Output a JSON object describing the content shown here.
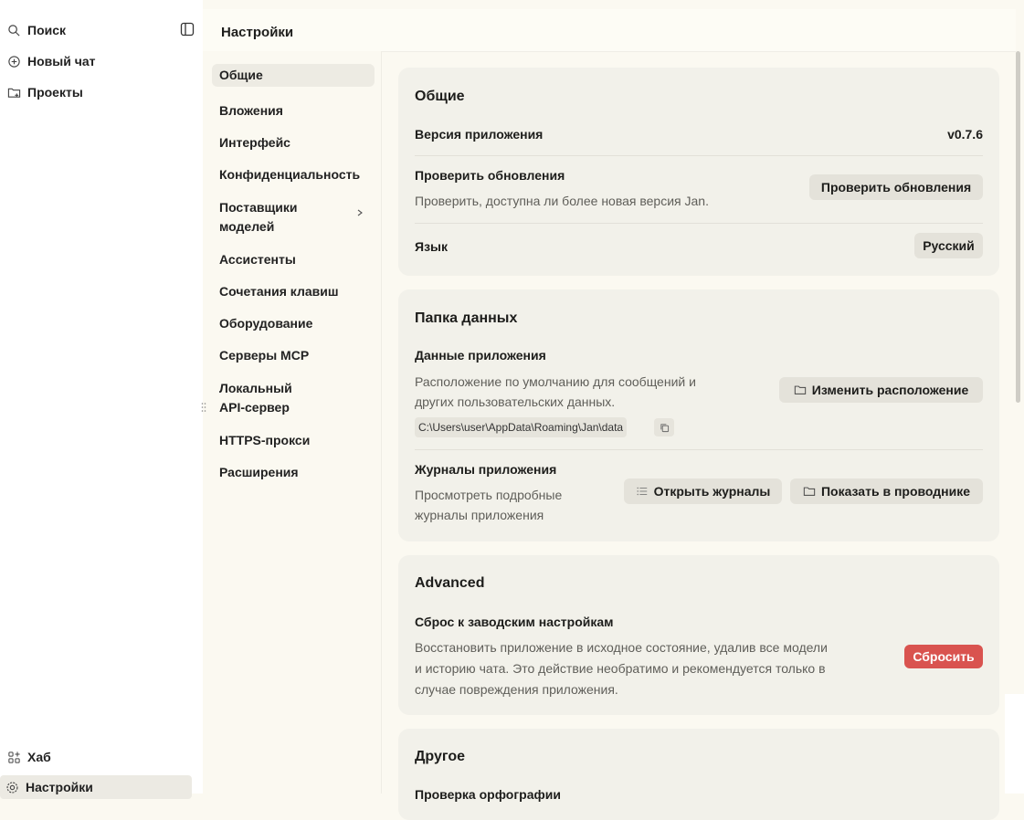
{
  "app_sidebar": {
    "search": "Поиск",
    "new_chat": "Новый чат",
    "projects": "Проекты",
    "hub": "Хаб",
    "settings": "Настройки"
  },
  "header": {
    "title": "Настройки"
  },
  "settings_nav": {
    "items": [
      "Общие",
      "Вложения",
      "Интерфейс",
      "Конфиденциальность",
      "Поставщики моделей",
      "Ассистенты",
      "Сочетания клавиш",
      "Оборудование",
      "Серверы MCP",
      "Локальный API-сервер",
      "HTTPS-прокси",
      "Расширения"
    ],
    "active": "Общие"
  },
  "general": {
    "title": "Общие",
    "app_version_label": "Версия приложения",
    "app_version_value": "v0.7.6",
    "check_updates_label": "Проверить обновления",
    "check_updates_desc": "Проверить, доступна ли более новая версия Jan.",
    "check_updates_button": "Проверить обновления",
    "language_label": "Язык",
    "language_value": "Русский"
  },
  "data_folder": {
    "title": "Папка данных",
    "app_data_label": "Данные приложения",
    "app_data_desc_line1": "Расположение по умолчанию для сообщений и",
    "app_data_desc_line2": "других пользовательских данных.",
    "path": "C:\\Users\\user\\AppData\\Roaming\\Jan\\data",
    "change_location_button": "Изменить расположение",
    "logs_label": "Журналы приложения",
    "logs_desc_line1": "Просмотреть подробные",
    "logs_desc_line2": "журналы приложения",
    "open_logs_button": "Открыть журналы",
    "show_in_explorer_button": "Показать в проводнике"
  },
  "advanced": {
    "title": "Advanced",
    "reset_label": "Сброс к заводским настройкам",
    "reset_desc_line1": "Восстановить приложение в исходное состояние, удалив все модели",
    "reset_desc_line2": "и историю чата. Это действие необратимо и рекомендуется только в",
    "reset_desc_line3": "случае повреждения приложения.",
    "reset_button": "Сбросить"
  },
  "other": {
    "title": "Другое",
    "spellcheck_label": "Проверка орфографии"
  },
  "colors": {
    "background": "#fbf9f1",
    "card": "#f2f1ea",
    "button": "#e4e2da",
    "danger": "#d9534f"
  }
}
